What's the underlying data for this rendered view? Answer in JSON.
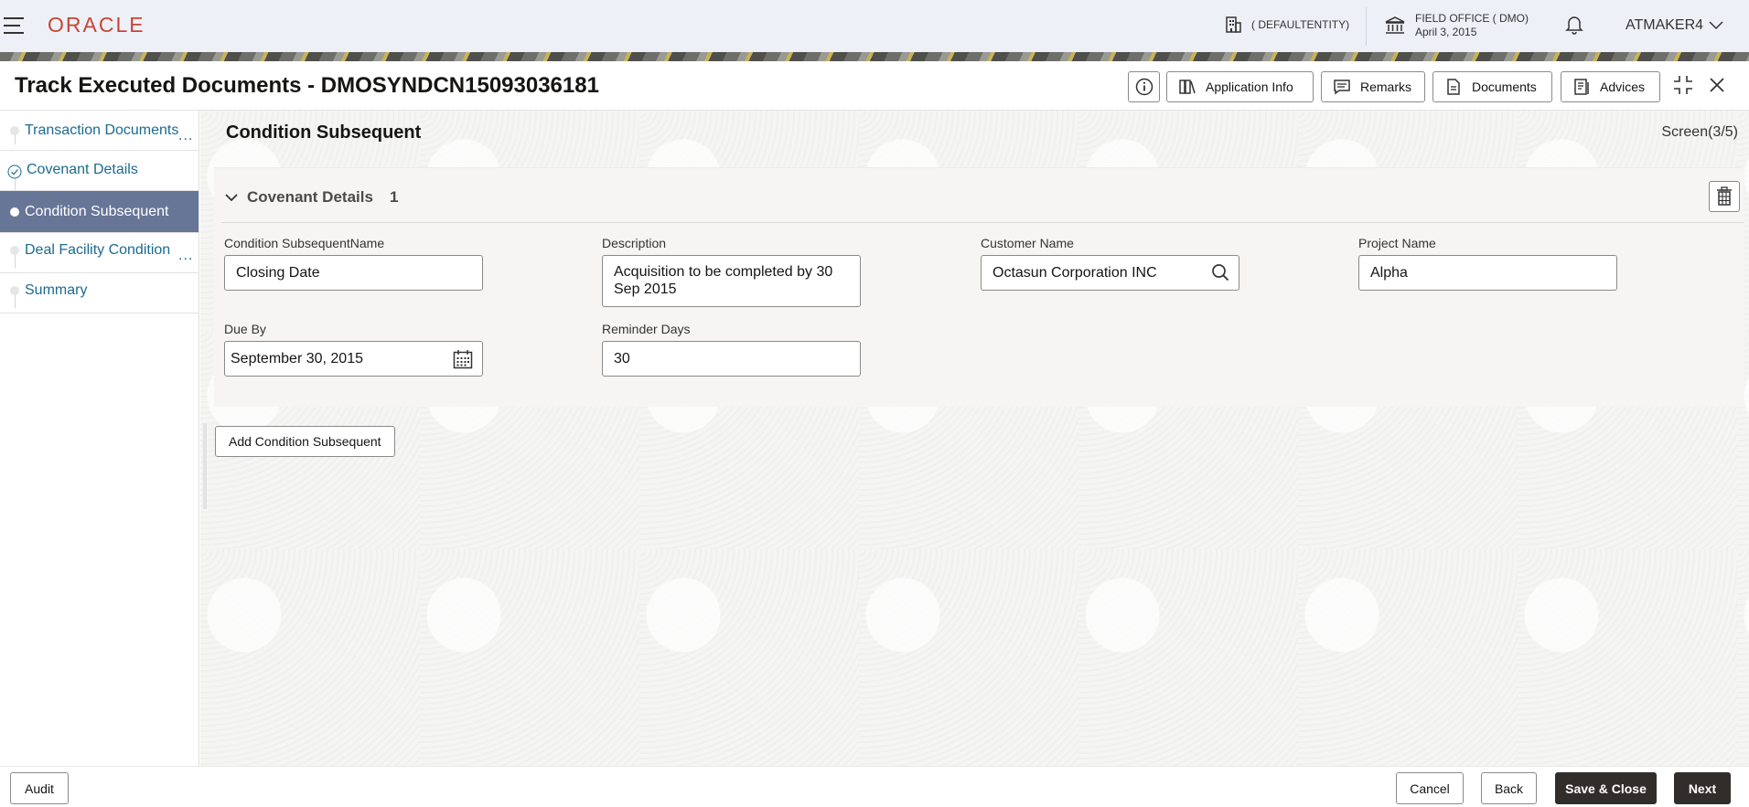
{
  "header": {
    "logo": "ORACLE",
    "entity": "( DEFAULTENTITY)",
    "office_name": "FIELD OFFICE ( DMO)",
    "office_date": "April 3, 2015",
    "user": "ATMAKER4"
  },
  "titlebar": {
    "title": "Track Executed Documents - DMOSYNDCN15093036181",
    "buttons": {
      "application_info": "Application Info",
      "remarks": "Remarks",
      "documents": "Documents",
      "advices": "Advices"
    }
  },
  "nav": {
    "items": [
      {
        "label": "Transaction Documents",
        "dots": "..."
      },
      {
        "label": "Covenant Details"
      },
      {
        "label": "Condition Subsequent"
      },
      {
        "label": "Deal Facility Condition",
        "dots": "..."
      },
      {
        "label": "Summary"
      }
    ]
  },
  "main": {
    "title": "Condition Subsequent",
    "screen": "Screen(3/5)",
    "card": {
      "title": "Covenant Details",
      "count": "1",
      "fields": {
        "name_label": "Condition SubsequentName",
        "name_value": "Closing Date",
        "description_label": "Description",
        "description_value": "Acquisition to be completed by 30 Sep 2015",
        "customer_label": "Customer Name",
        "customer_value": "Octasun Corporation INC",
        "project_label": "Project Name",
        "project_value": "Alpha",
        "due_label": "Due By",
        "due_value": "September 30, 2015",
        "reminder_label": "Reminder Days",
        "reminder_value": "30"
      }
    },
    "add_button": "Add Condition Subsequent"
  },
  "footer": {
    "audit": "Audit",
    "cancel": "Cancel",
    "back": "Back",
    "save_close": "Save & Close",
    "next": "Next"
  }
}
